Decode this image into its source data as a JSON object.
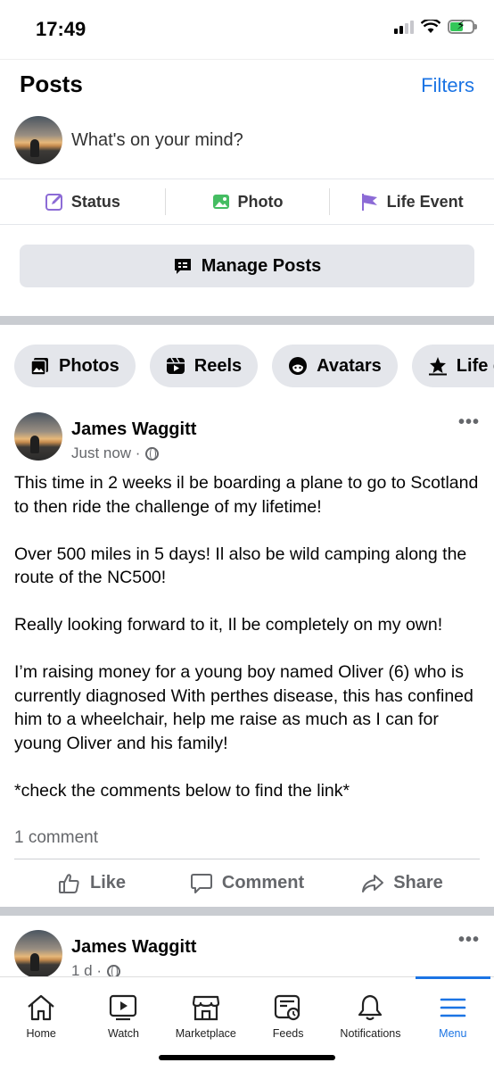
{
  "status_bar": {
    "time": "17:49"
  },
  "header": {
    "title": "Posts",
    "filters": "Filters"
  },
  "composer": {
    "placeholder": "What's on your mind?"
  },
  "post_actions": [
    {
      "label": "Status",
      "icon": "edit-icon",
      "color": "#8c6bd6"
    },
    {
      "label": "Photo",
      "icon": "photo-icon",
      "color": "#45bd62"
    },
    {
      "label": "Life Event",
      "icon": "flag-icon",
      "color": "#8c6bd6"
    }
  ],
  "manage_posts": {
    "label": "Manage Posts"
  },
  "chips": [
    {
      "label": "Photos",
      "icon": "photos-icon"
    },
    {
      "label": "Reels",
      "icon": "reels-icon"
    },
    {
      "label": "Avatars",
      "icon": "avatar-icon"
    },
    {
      "label": "Life events",
      "icon": "star-icon"
    }
  ],
  "post1": {
    "author": "James Waggitt",
    "time": "Just now ·",
    "paragraphs": [
      "This time in 2 weeks il be boarding a plane to go to Scotland to then ride the challenge of my lifetime!",
      "Over 500 miles in 5 days! Il also be wild camping along the route of the NC500!",
      "Really looking forward to it, Il be completely on my own!",
      "I’m raising money for a young boy named Oliver (6) who is currently diagnosed With perthes disease, this has confined him to a wheelchair, help me raise as much as I can for young Oliver and his family!",
      "*check the comments below to find the link*"
    ],
    "comment_count": "1 comment",
    "reactions": {
      "like": "Like",
      "comment": "Comment",
      "share": "Share"
    }
  },
  "post2": {
    "author": "James Waggitt",
    "time": "1 d ·"
  },
  "tabbar": {
    "items": [
      {
        "label": "Home",
        "icon": "home-icon"
      },
      {
        "label": "Watch",
        "icon": "watch-icon"
      },
      {
        "label": "Marketplace",
        "icon": "marketplace-icon"
      },
      {
        "label": "Feeds",
        "icon": "feeds-icon"
      },
      {
        "label": "Notifications",
        "icon": "bell-icon"
      },
      {
        "label": "Menu",
        "icon": "menu-icon",
        "active": true
      }
    ]
  },
  "colors": {
    "accent": "#1b74e4",
    "chip_bg": "#e4e6eb",
    "muted_text": "#65676b"
  }
}
